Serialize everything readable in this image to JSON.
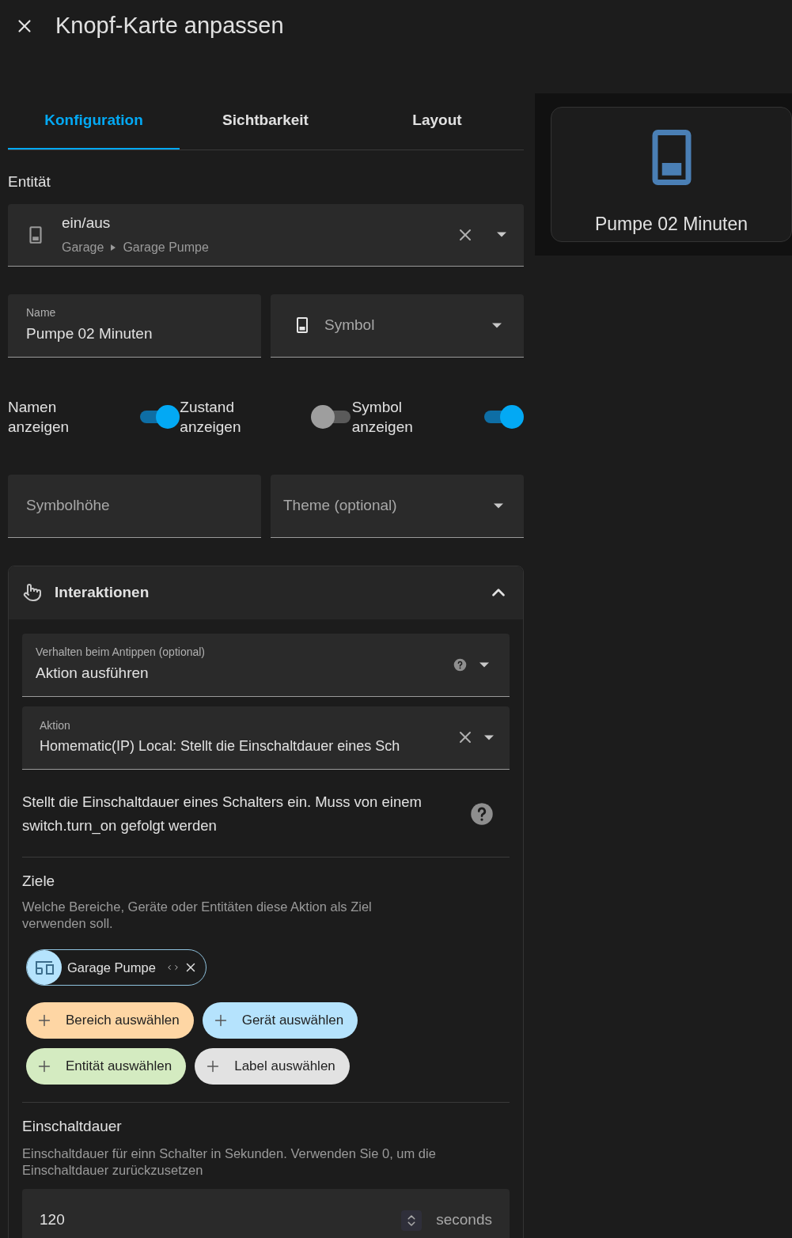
{
  "dialog": {
    "title": "Knopf-Karte anpassen"
  },
  "tabs": [
    {
      "label": "Konfiguration",
      "selected": true
    },
    {
      "label": "Sichtbarkeit",
      "selected": false
    },
    {
      "label": "Layout",
      "selected": false
    }
  ],
  "entity": {
    "label": "Entität",
    "value": "ein/aus",
    "path": [
      "Garage",
      "Garage Pumpe"
    ]
  },
  "name_field": {
    "label": "Name",
    "value": "Pumpe 02 Minuten"
  },
  "icon_field": {
    "placeholder": "Symbol"
  },
  "toggles": [
    {
      "label": "Namen anzeigen",
      "on": true
    },
    {
      "label": "Zustand anzeigen",
      "on": false
    },
    {
      "label": "Symbol anzeigen",
      "on": true
    }
  ],
  "height_field": {
    "placeholder": "Symbolhöhe"
  },
  "theme_field": {
    "placeholder": "Theme (optional)"
  },
  "interactions": {
    "title": "Interaktionen",
    "expanded": true,
    "tap_field": {
      "label": "Verhalten beim Antippen (optional)",
      "value": "Aktion ausführen"
    },
    "action_field": {
      "label": "Aktion",
      "value": "Homematic(IP) Local: Stellt die Einschaltdauer eines Sch"
    },
    "description": "Stellt die Einschaltdauer eines Schalters ein. Muss von einem switch.turn_on gefolgt werden",
    "targets": {
      "title": "Ziele",
      "description": "Welche Bereiche, Geräte oder Entitäten diese Aktion als Ziel verwenden soll.",
      "chips": [
        {
          "label": "Garage Pumpe"
        }
      ],
      "add_buttons": [
        {
          "label": "Bereich auswählen",
          "color": "#fed6a4"
        },
        {
          "label": "Gerät auswählen",
          "color": "#b5e3fd"
        },
        {
          "label": "Entität auswählen",
          "color": "#d4ebc1"
        },
        {
          "label": "Label auswählen",
          "color": "#e2e2e2"
        }
      ]
    },
    "duration": {
      "title": "Einschaltdauer",
      "description": "Einschaltdauer für einn Schalter in Sekunden. Verwenden Sie 0, um die Einschaltdauer zurückzusetzen",
      "value": "120",
      "unit": "seconds"
    }
  },
  "preview": {
    "name": "Pumpe 02 Minuten"
  }
}
